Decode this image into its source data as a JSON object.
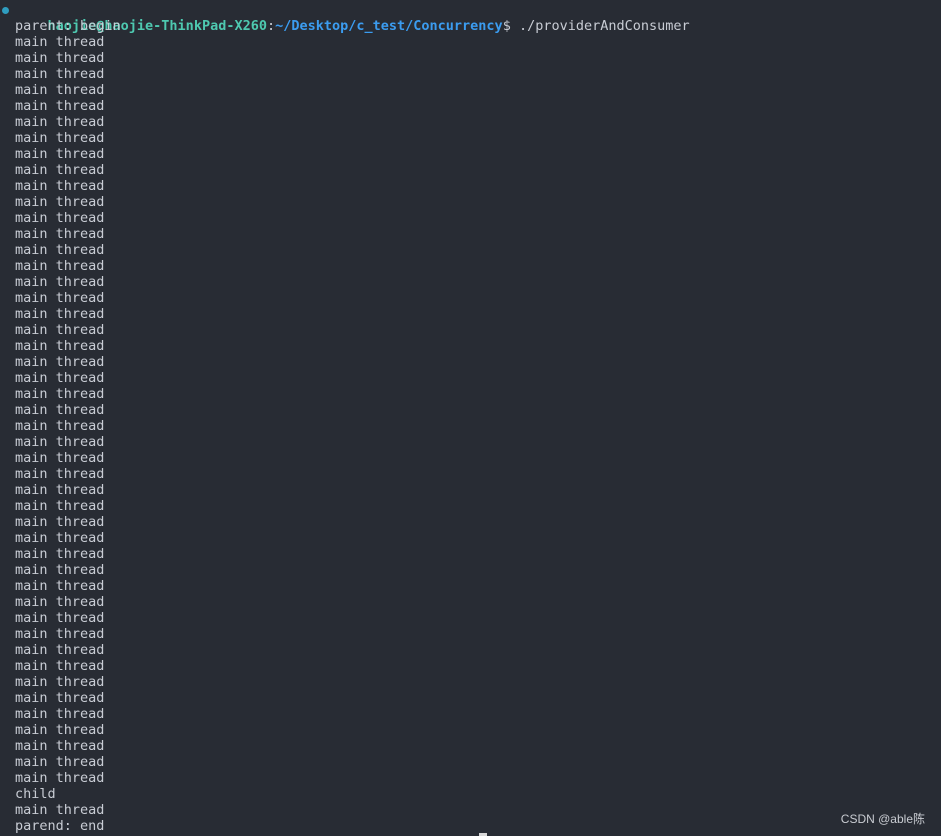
{
  "prompt": {
    "user_host": "haojie@haojie-ThinkPad-X260",
    "separator": ":",
    "path": "~/Desktop/c_test/Concurrency",
    "symbol": "$ ",
    "command": "./providerAndConsumer"
  },
  "output": [
    "parent: begin",
    "main thread",
    "main thread",
    "main thread",
    "main thread",
    "main thread",
    "main thread",
    "main thread",
    "main thread",
    "main thread",
    "main thread",
    "main thread",
    "main thread",
    "main thread",
    "main thread",
    "main thread",
    "main thread",
    "main thread",
    "main thread",
    "main thread",
    "main thread",
    "main thread",
    "main thread",
    "main thread",
    "main thread",
    "main thread",
    "main thread",
    "main thread",
    "main thread",
    "main thread",
    "main thread",
    "main thread",
    "main thread",
    "main thread",
    "main thread",
    "main thread",
    "main thread",
    "main thread",
    "main thread",
    "main thread",
    "main thread",
    "main thread",
    "main thread",
    "main thread",
    "main thread",
    "main thread",
    "main thread",
    "main thread",
    "child",
    "main thread",
    "parend: end"
  ],
  "watermark": "CSDN @able陈",
  "colors": {
    "background": "#282c34",
    "user_host": "#4ec9b0",
    "path": "#3b9cf0",
    "text": "#c8ccd4"
  }
}
